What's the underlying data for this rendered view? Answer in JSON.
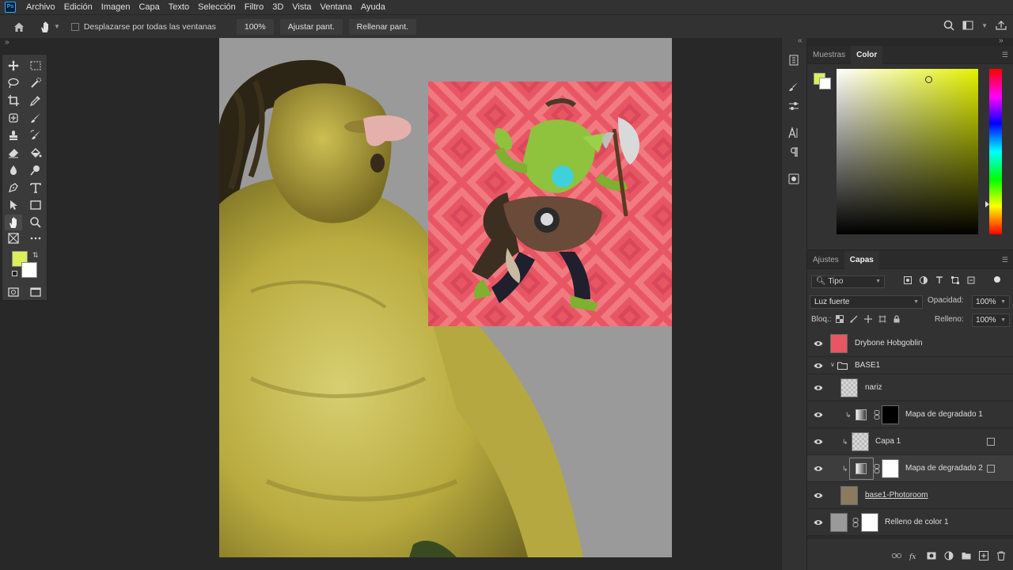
{
  "app": {
    "logo_text": "Ps",
    "menu": [
      "Archivo",
      "Edición",
      "Imagen",
      "Capa",
      "Texto",
      "Selección",
      "Filtro",
      "3D",
      "Vista",
      "Ventana",
      "Ayuda"
    ]
  },
  "options_bar": {
    "scroll_all_label": "Desplazarse por todas las ventanas",
    "zoom_btn": "100%",
    "fit_btn": "Ajustar pant.",
    "fill_btn": "Rellenar pant."
  },
  "toolbar": {
    "foreground_color": "#dcee5a",
    "background_color": "#ffffff"
  },
  "panels": {
    "color": {
      "tabs": [
        "Muestras",
        "Color"
      ],
      "active_tab": "Color",
      "foreground": "#dcee5a",
      "hue": "#e4f200"
    },
    "layers": {
      "tabs": [
        "Ajustes",
        "Capas"
      ],
      "active_tab": "Capas",
      "filter_kind": "Tipo",
      "blend_mode": "Luz fuerte",
      "opacity_label": "Opacidad:",
      "opacity": "100%",
      "lock_label": "Bloq.:",
      "fill_label": "Relleno:",
      "fill": "100%",
      "items": [
        {
          "name": "Drybone Hobgoblin"
        },
        {
          "name": "BASE1"
        },
        {
          "name": "nariz"
        },
        {
          "name": "Mapa de degradado 1"
        },
        {
          "name": "Capa 1"
        },
        {
          "name": "Mapa de degradado 2"
        },
        {
          "name": "base1-Photoroom"
        },
        {
          "name": "Relleno de color 1"
        }
      ]
    }
  }
}
